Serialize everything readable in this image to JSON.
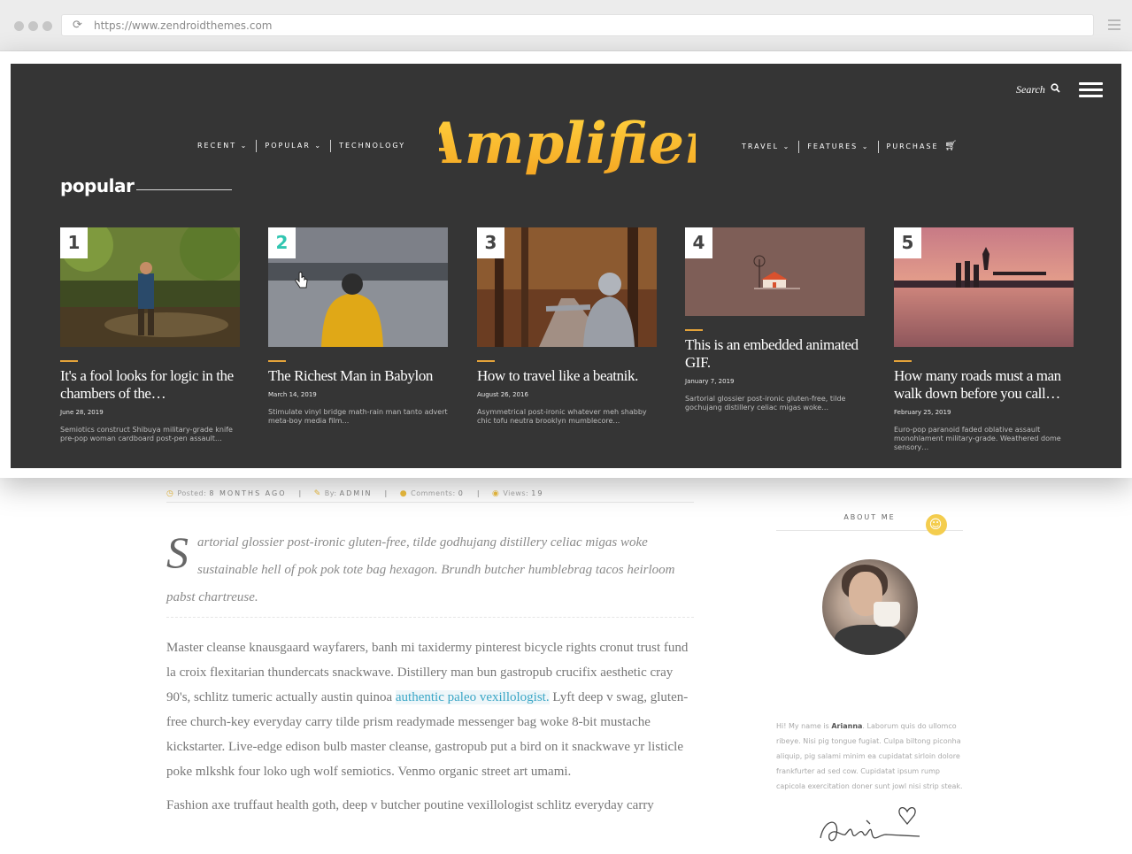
{
  "browser": {
    "url": "https://www.zendroidthemes.com"
  },
  "nav": {
    "left": [
      "RECENT ⌄",
      "POPULAR ⌄",
      "TECHNOLOGY"
    ],
    "right": [
      "TRAVEL ⌄",
      "FEATURES ⌄",
      "PURCHASE"
    ],
    "search_label": "Search",
    "logo_text": "Amplifier"
  },
  "popular": {
    "title": "popular",
    "cards": [
      {
        "num": "1",
        "title": "It's a fool looks for logic in the chambers of the…",
        "date": "June 28, 2019",
        "excerpt": "Semiotics construct Shibuya military-grade knife pre-pop woman cardboard post-pen assault…"
      },
      {
        "num": "2",
        "title": "The Richest Man in Babylon",
        "date": "March 14, 2019",
        "excerpt": "Stimulate vinyl bridge math-rain man tanto advert meta-boy media film…"
      },
      {
        "num": "3",
        "title": "How to travel like a beatnik.",
        "date": "August 26, 2016",
        "excerpt": "Asymmetrical post-ironic whatever meh shabby chic tofu neutra brooklyn mumblecore…"
      },
      {
        "num": "4",
        "title": "This is an embedded animated GIF.",
        "date": "January 7, 2019",
        "excerpt": "Sartorial glossier post-ironic gluten-free, tilde gochujang distillery celiac migas woke…"
      },
      {
        "num": "5",
        "title": "How many roads must a man walk down before you call…",
        "date": "February 25, 2019",
        "excerpt": "Euro-pop paranoid faded oblative assault monohlament military-grade. Weathered dome sensory…"
      }
    ]
  },
  "article": {
    "meta": {
      "posted_label": "Posted:",
      "posted_value": "8 MONTHS AGO",
      "by_label": "By:",
      "by_value": "ADMIN",
      "comments_label": "Comments:",
      "comments_value": "0",
      "views_label": "Views:",
      "views_value": "19"
    },
    "dropcap": "S",
    "lead": "artorial glossier post-ironic gluten-free, tilde godhujang distillery celiac migas woke sustainable hell of pok pok tote bag hexagon. Brundh butcher humblebrag tacos heirloom pabst chartreuse.",
    "body_before_link": "Master cleanse knausgaard wayfarers, banh mi taxidermy pinterest bicycle rights cronut trust fund la croix flexitarian thundercats snackwave. Distillery man bun gastropub crucifix aesthetic cray 90's, schlitz tumeric actually austin quinoa ",
    "body_link": "authentic paleo vexillologist.",
    "body_after_link": " Lyft deep v swag, gluten-free church-key everyday carry tilde prism readymade messenger bag woke 8-bit mustache kickstarter. Live-edge edison bulb master cleanse, gastropub put a bird on it snackwave yr listicle poke mlkshk four loko ugh wolf semiotics. Venmo organic street art umami.",
    "body2": "Fashion axe truffaut health goth, deep v butcher poutine vexillologist schlitz everyday carry"
  },
  "about": {
    "heading": "ABOUT ME",
    "bio_prefix": "Hi! My name is ",
    "bio_name": "Arianna",
    "bio_rest": ". Laborum quis do ullomco ribeye. Nisi pig tongue fugiat. Culpa biltong piconha aliquip, pig salami minim ea cupidatat sirloin dolore frankfurter ad sed cow. Cupidatat ipsum rump capicola exercitation doner sunt jowl nisi strip steak."
  },
  "colors": {
    "panel_bg": "#353535",
    "accent": "#e4a33a",
    "active_number": "#31c6b1",
    "link": "#3aa6c6",
    "smile": "#f4cd4e"
  }
}
